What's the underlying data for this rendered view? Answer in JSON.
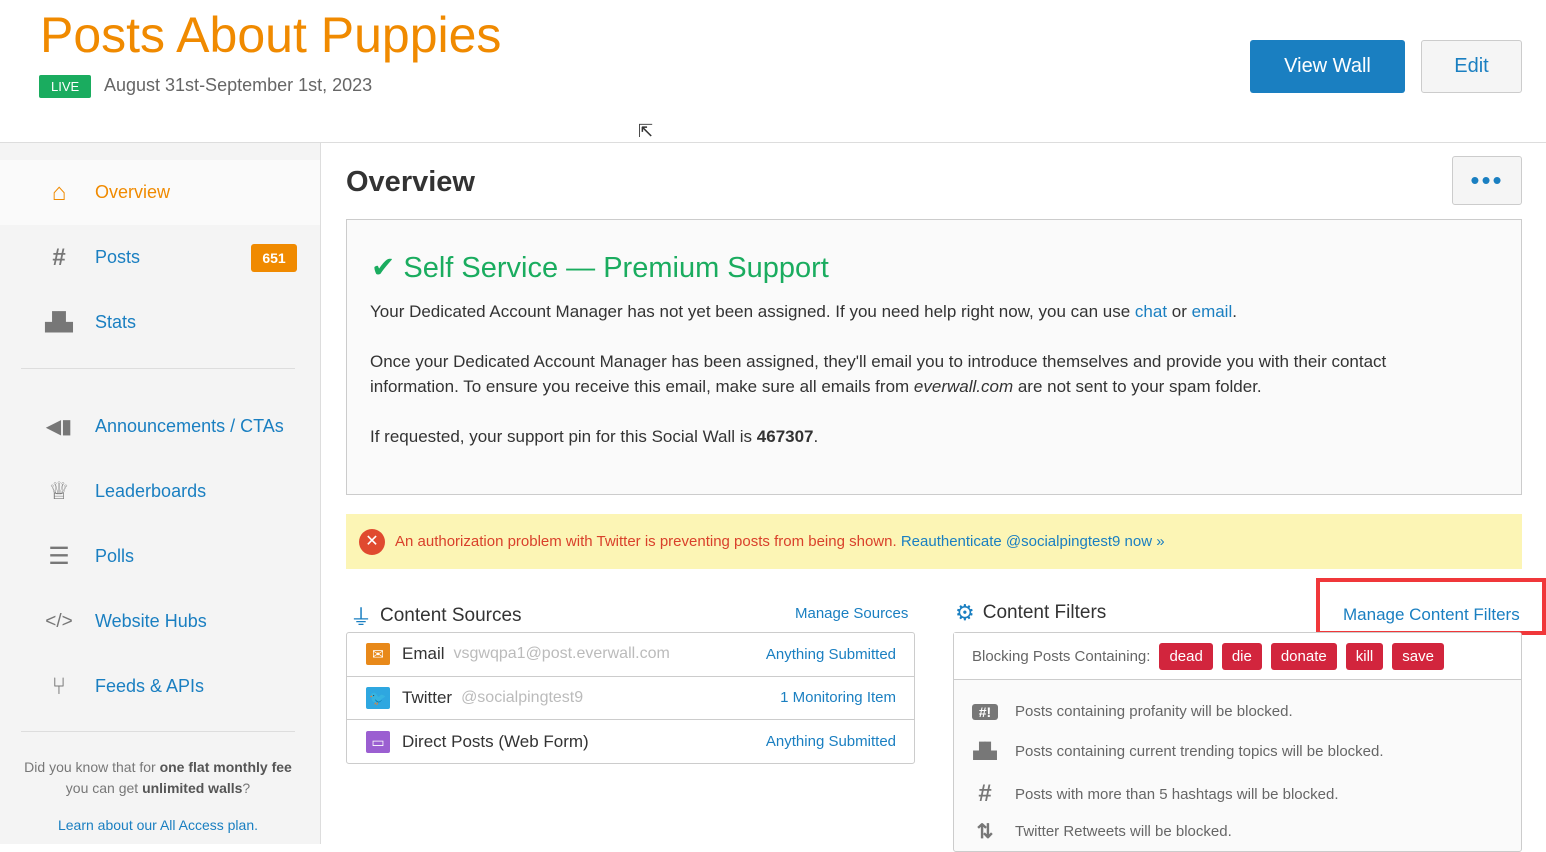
{
  "header": {
    "title": "Posts About Puppies",
    "status": "LIVE",
    "dates": "August 31st-September 1st, 2023",
    "view_wall": "View Wall",
    "edit": "Edit"
  },
  "sidebar": {
    "items": [
      {
        "label": "Overview",
        "icon": "home-icon"
      },
      {
        "label": "Posts",
        "icon": "hashtag-icon",
        "badge": "651"
      },
      {
        "label": "Stats",
        "icon": "chart-icon"
      },
      {
        "label": "Announcements / CTAs",
        "icon": "megaphone-icon"
      },
      {
        "label": "Leaderboards",
        "icon": "trophy-icon"
      },
      {
        "label": "Polls",
        "icon": "list-icon"
      },
      {
        "label": "Website Hubs",
        "icon": "code-icon"
      },
      {
        "label": "Feeds & APIs",
        "icon": "branch-icon"
      }
    ],
    "promo_1": "Did you know that for ",
    "promo_b1": "one flat monthly fee",
    "promo_2": " you can get ",
    "promo_b2": "unlimited walls",
    "promo_3": "?",
    "learn_pre": "Learn about our All Access plan."
  },
  "main": {
    "title": "Overview",
    "more": "•••",
    "support": {
      "heading": "Self Service — Premium Support",
      "p1_pre": "Your Dedicated Account Manager has not yet been assigned. If you need help right now, you can use ",
      "chat": "chat",
      "p1_mid": " or ",
      "email": "email",
      "p1_end": ".",
      "p2_pre": "Once your Dedicated Account Manager has been assigned, they'll email you to introduce themselves and provide you with their contact information. To ensure you receive this email, make sure all emails from ",
      "p2_domain": "everwall.com",
      "p2_end": " are not sent to your spam folder.",
      "p3_pre": "If requested, your support pin for this Social Wall is ",
      "pin": "467307",
      "p3_end": "."
    },
    "alert": {
      "text": "An authorization problem with Twitter is preventing posts from being shown. ",
      "link": "Reauthenticate @socialpingtest9 now »"
    },
    "sources": {
      "title": "Content Sources",
      "manage": "Manage Sources",
      "rows": [
        {
          "name": "Email",
          "sub": "vsgwqpa1@post.everwall.com",
          "status": "Anything Submitted",
          "color": "#e8891a"
        },
        {
          "name": "Twitter",
          "sub": "@socialpingtest9",
          "status": "1 Monitoring Item",
          "color": "#2ea7e0"
        },
        {
          "name": "Direct Posts (Web Form)",
          "sub": "",
          "status": "Anything Submitted",
          "color": "#9b5fd1"
        }
      ]
    },
    "filters": {
      "title": "Content Filters",
      "manage": "Manage Content Filters",
      "blocking_label": "Blocking Posts Containing:",
      "tags": [
        "dead",
        "die",
        "donate",
        "kill",
        "save"
      ],
      "rules": [
        "Posts containing profanity will be blocked.",
        "Posts containing current trending topics will be blocked.",
        "Posts with more than 5 hashtags will be blocked.",
        "Twitter Retweets will be blocked."
      ]
    }
  }
}
